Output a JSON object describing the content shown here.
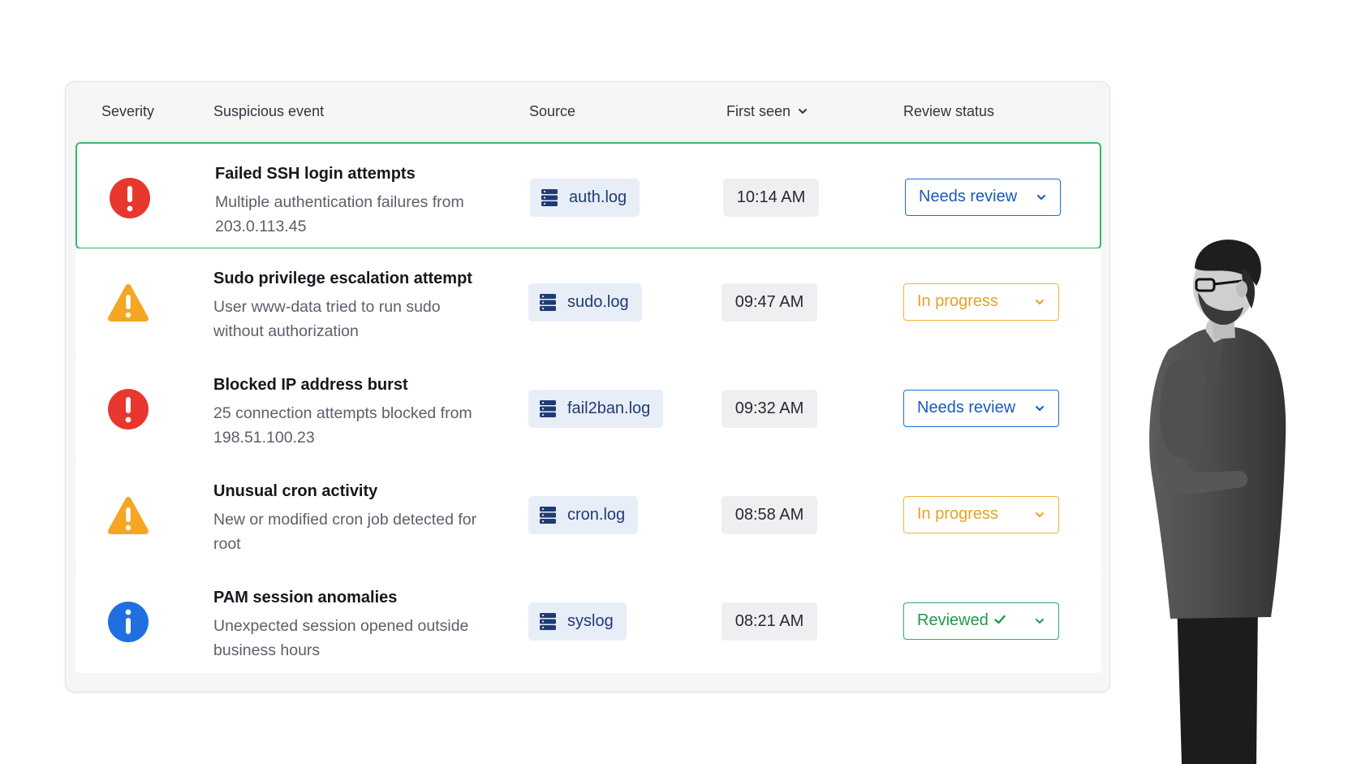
{
  "table": {
    "headers": {
      "severity": "Severity",
      "event": "Suspicious event",
      "source": "Source",
      "first_seen": "First seen",
      "status": "Review status"
    },
    "rows": [
      {
        "severity": "critical",
        "severity_icon": "exclamation-circle-icon",
        "title": "Failed SSH login attempts",
        "description": "Multiple authentication failures from 203.0.113.45",
        "source": "auth.log",
        "first_seen": "10:14 AM",
        "status": "Needs review",
        "status_color": "#1d6bd6",
        "selected": true
      },
      {
        "severity": "warning",
        "severity_icon": "warning-triangle-icon",
        "title": "Sudo privilege escalation attempt",
        "description": "User www-data tried to run sudo without authorization",
        "source": "sudo.log",
        "first_seen": "09:47 AM",
        "status": "In progress",
        "status_color": "#f2b43c"
      },
      {
        "severity": "critical",
        "severity_icon": "exclamation-circle-icon",
        "title": "Blocked IP address burst",
        "description": "25 connection attempts blocked from 198.51.100.23",
        "source": "fail2ban.log",
        "first_seen": "09:32 AM",
        "status": "Needs review",
        "status_color": "#1d6bd6"
      },
      {
        "severity": "warning",
        "severity_icon": "warning-triangle-icon",
        "title": "Unusual cron activity",
        "description": "New or modified cron job detected for root",
        "source": "cron.log",
        "first_seen": "08:58 AM",
        "status": "In progress",
        "status_color": "#f2b43c"
      },
      {
        "severity": "info",
        "severity_icon": "info-circle-icon",
        "title": "PAM session anomalies",
        "description": "Unexpected session opened outside business hours",
        "source": "syslog",
        "first_seen": "08:21 AM",
        "status": "Reviewed",
        "status_color": "#2fae5c"
      }
    ]
  },
  "colors": {
    "critical": "#e8372f",
    "warning": "#f5a623",
    "info": "#1f6fe0",
    "selected_border": "#37b86a"
  }
}
